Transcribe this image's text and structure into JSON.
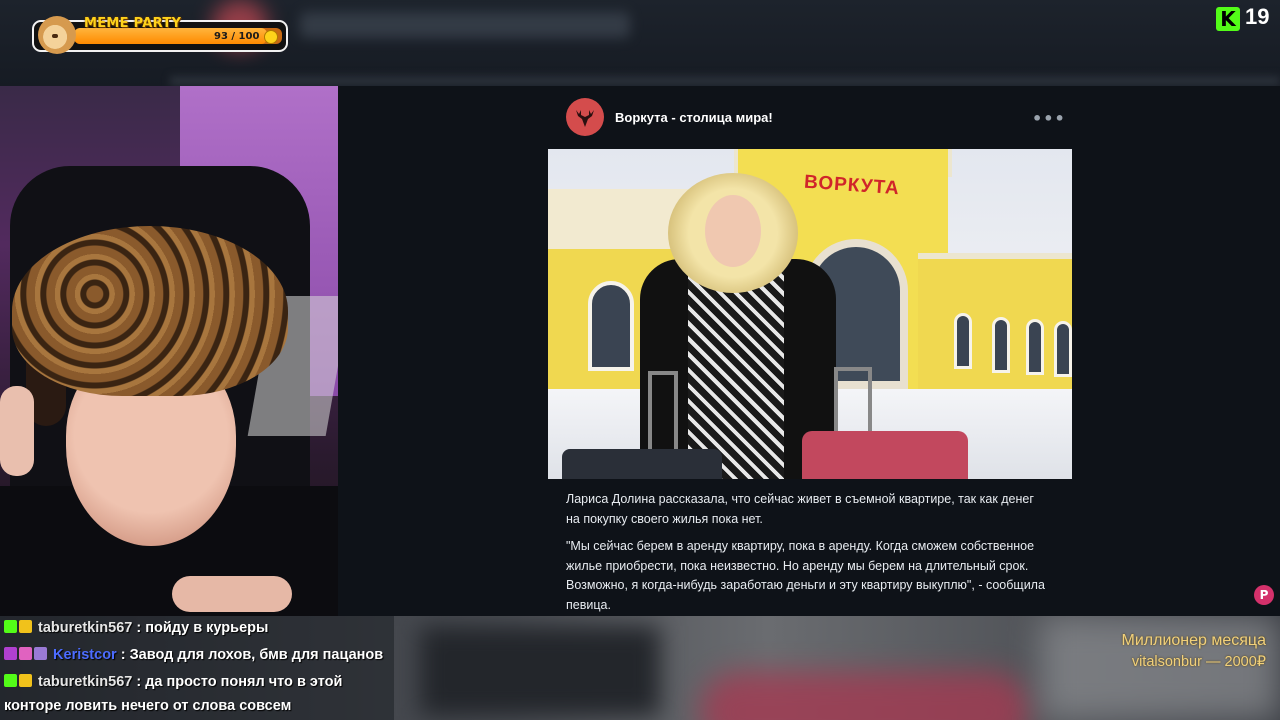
{
  "meme_party": {
    "title": "MEME PARTY",
    "count": "93 / 100",
    "progress_fraction": 0.93
  },
  "kick": {
    "viewers": "19",
    "logo": "K"
  },
  "post": {
    "channel": "Воркута - столица мира!",
    "more": "•••",
    "photo_sign": "ВОРКУТА",
    "paragraph1": "Лариса Долина рассказала, что сейчас живет в съемной квартире, так как денег на покупку своего жилья пока нет.",
    "paragraph2": "\"Мы сейчас берем в аренду квартиру, пока в аренду. Когда сможем собственное жилье приобрести, пока неизвестно. Но аренду мы берем на длительный срок. Возможно, я когда-нибудь заработаю деньги и эту квартиру выкуплю\", - сообщила певица."
  },
  "r_icon": "P",
  "chat": {
    "messages": [
      {
        "user": "taburetkin567",
        "sep": " : ",
        "text": "пойду в курьеры"
      },
      {
        "user": "Keristcor",
        "sep": " : ",
        "text": "Завод для лохов, бмв для пацанов"
      },
      {
        "user": "taburetkin567",
        "sep": " : ",
        "text": "да просто понял что в этой"
      },
      {
        "user": "",
        "sep": "",
        "text": "конторе ловить нечего от слова совсем"
      }
    ]
  },
  "millionaire": {
    "title": "Миллионер месяца",
    "entry": "vitalsonbur — 2000₽"
  },
  "colors": {
    "kick_green": "#53fc18",
    "accent_red": "#d44c4c",
    "gold": "#f1d07a"
  }
}
